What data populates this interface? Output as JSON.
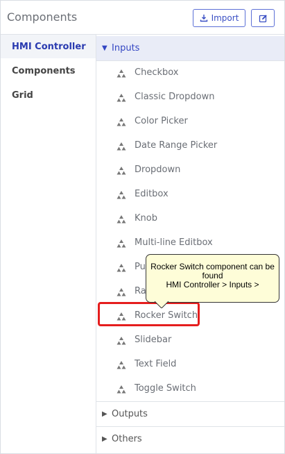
{
  "header": {
    "title": "Components",
    "import_label": "Import"
  },
  "sidebar": {
    "items": [
      {
        "label": "HMI Controller",
        "active": true
      },
      {
        "label": "Components",
        "active": false
      },
      {
        "label": "Grid",
        "active": false
      }
    ]
  },
  "groups": {
    "inputs": {
      "label": "Inputs",
      "items": [
        "Checkbox",
        "Classic Dropdown",
        "Color Picker",
        "Date Range Picker",
        "Dropdown",
        "Editbox",
        "Knob",
        "Multi-line Editbox",
        "Pu",
        "Ra",
        "Rocker Switch",
        "Slidebar",
        "Text Field",
        "Toggle Switch"
      ]
    },
    "outputs": {
      "label": "Outputs"
    },
    "others": {
      "label": "Others"
    }
  },
  "callout": {
    "line1": "Rocker Switch component can be",
    "line2": "found",
    "line3": "HMI Controller > Inputs >"
  },
  "colors": {
    "accent": "#3346c3",
    "highlight": "#e51d1d",
    "callout_bg": "#fefdd8"
  }
}
